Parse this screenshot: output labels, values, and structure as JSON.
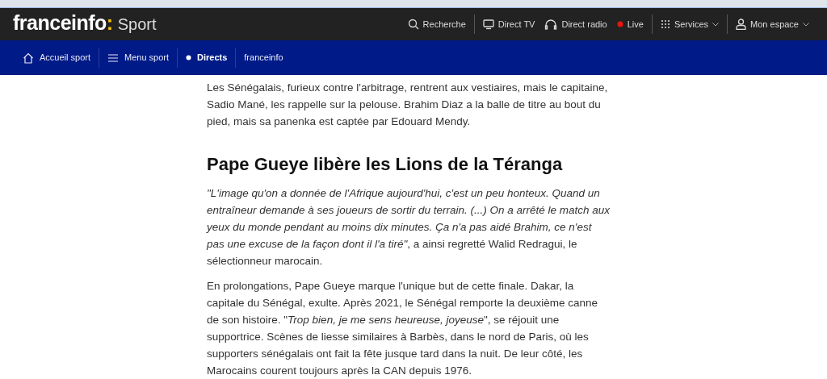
{
  "logo": {
    "name": "franceinfo",
    "separator": ":",
    "section": "Sport"
  },
  "top_menu": [
    {
      "label": "Recherche"
    },
    {
      "label": "Direct TV"
    },
    {
      "label": "Direct radio"
    },
    {
      "label": "Live"
    },
    {
      "label": "Services"
    },
    {
      "label": "Mon espace"
    }
  ],
  "sub_menu": [
    {
      "label": "Accueil sport",
      "selected": false
    },
    {
      "label": "Menu sport",
      "selected": false
    },
    {
      "label": "Directs",
      "selected": true
    },
    {
      "label": "franceinfo",
      "selected": false
    }
  ],
  "article": [
    {
      "kind": "paragraph",
      "text": "Les Sénégalais, furieux contre l'arbitrage, rentrent aux vestiaires, mais le capitaine, Sadio Mané, les rappelle sur la pelouse. Brahim Diaz a la balle de titre au bout du pied, mais sa panenka est captée par Edouard Mendy."
    },
    {
      "kind": "heading",
      "text": "Pape Gueye libère les Lions de la Téranga"
    },
    {
      "kind": "paragraph",
      "text": "*\"L'image qu'on a donnée de l'Afrique aujourd'hui, c'est un peu honteux. Quand un entraîneur demande à ses joueurs de sortir du terrain. (...) On a arrêté le match aux yeux du monde pendant au moins dix minutes. Ça n'a pas aidé Brahim, ce n'est pas une excuse de la façon dont il l'a tiré\"*, a ainsi regretté Walid Redragui, le sélectionneur marocain."
    },
    {
      "kind": "paragraph",
      "text": "En prolongations, Pape Gueye marque l'unique but de cette finale. Dakar, la capitale du Sénégal, exulte. Après 2021, le Sénégal remporte la deuxième canne de son histoire. \"*Trop bien, je me sens heureuse, joyeuse*\", se réjouit une supportrice. Scènes de liesse similaires à Barbès, dans le nord de Paris, où les supporters sénégalais ont fait la fête jusque tard dans la nuit. De leur côté, les Marocains courent toujours après la CAN depuis 1976."
    }
  ]
}
